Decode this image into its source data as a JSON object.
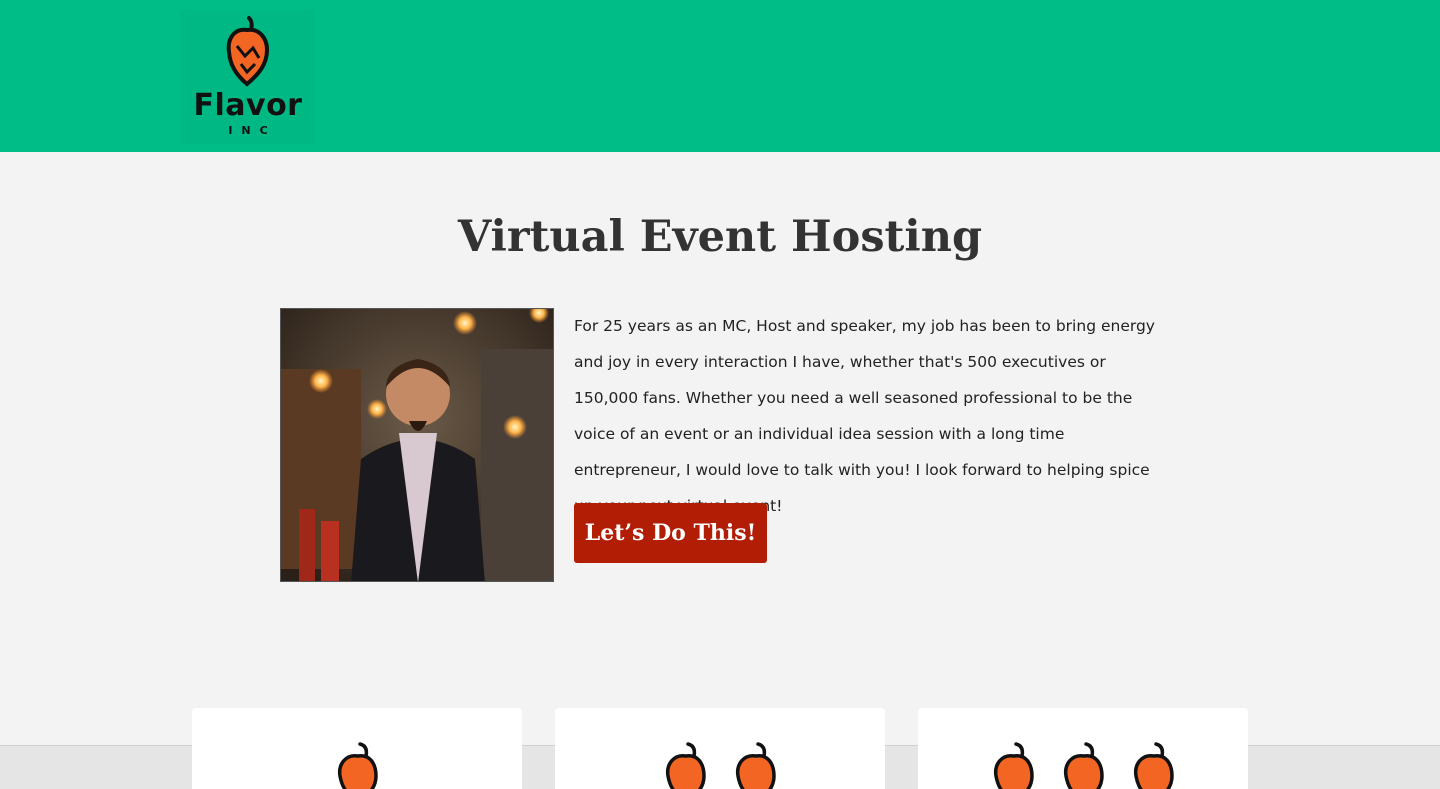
{
  "header": {
    "logo_word": "Flavor",
    "logo_sub": "INC",
    "brand_color": "#00bc87"
  },
  "main": {
    "title": "Virtual Event Hosting",
    "photo_icon": "host-portrait",
    "bio": "For 25 years as an MC, Host and speaker, my job has been to bring energy and joy in every interaction I have, whether that's 500 executives or 150,000 fans. Whether you need a well seasoned professional to be the voice of an event or an individual idea session with a long time entrepreneur, I would love to talk with you! I look forward to helping spice up your next virtual event!",
    "cta_label": "Let’s Do This!",
    "cta_color": "#b21e05"
  },
  "cards": [
    {
      "pepper_count": 1,
      "icon": "pepper-icon"
    },
    {
      "pepper_count": 2,
      "icon": "pepper-icon"
    },
    {
      "pepper_count": 3,
      "icon": "pepper-icon"
    }
  ]
}
